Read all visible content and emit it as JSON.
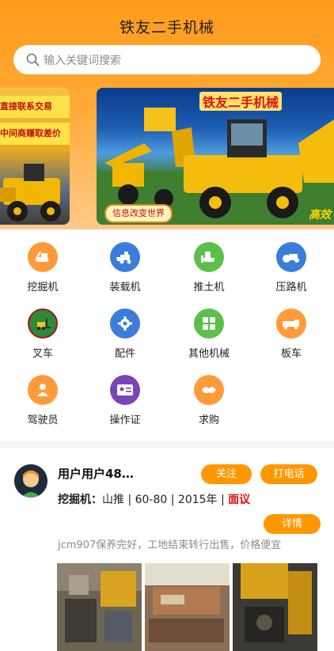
{
  "header": {
    "title": "铁友二手机械",
    "search_placeholder": "输入关键词搜索"
  },
  "banners": {
    "left_lines": [
      "直接联系交易",
      "中间商赚取差价"
    ],
    "main_title": "铁友二手机械",
    "main_slogan": "信息改变世界",
    "main_corner": "高效"
  },
  "categories": [
    {
      "label": "挖掘机",
      "icon": "excavator-icon",
      "color": "#ff9a3a"
    },
    {
      "label": "装载机",
      "icon": "loader-icon",
      "color": "#3b7ddb"
    },
    {
      "label": "推土机",
      "icon": "bulldozer-icon",
      "color": "#5cbf4a"
    },
    {
      "label": "压路机",
      "icon": "road-roller-icon",
      "color": "#3b7ddb"
    },
    {
      "label": "叉车",
      "icon": "forklift-icon",
      "color": "#2d8a3a"
    },
    {
      "label": "配件",
      "icon": "gear-icon",
      "color": "#3b7ddb"
    },
    {
      "label": "其他机械",
      "icon": "grid-icon",
      "color": "#5cbf4a"
    },
    {
      "label": "板车",
      "icon": "truck-icon",
      "color": "#ff9a3a"
    },
    {
      "label": "驾驶员",
      "icon": "driver-icon",
      "color": "#ff9a3a"
    },
    {
      "label": "操作证",
      "icon": "id-card-icon",
      "color": "#7a45b8"
    },
    {
      "label": "求购",
      "icon": "handshake-icon",
      "color": "#ff9a3a"
    }
  ],
  "listing": {
    "username": "用户用户48…",
    "follow_label": "关注",
    "call_label": "打电话",
    "details_label": "详情",
    "category": "挖掘机：",
    "specs": "山推 | 60-80 | 2015年 | ",
    "price": "面议",
    "description": "jcm907保养完好，工地结束转行出售，价格便宜"
  },
  "colors": {
    "accent": "#ff9800",
    "price_red": "#e01010"
  }
}
